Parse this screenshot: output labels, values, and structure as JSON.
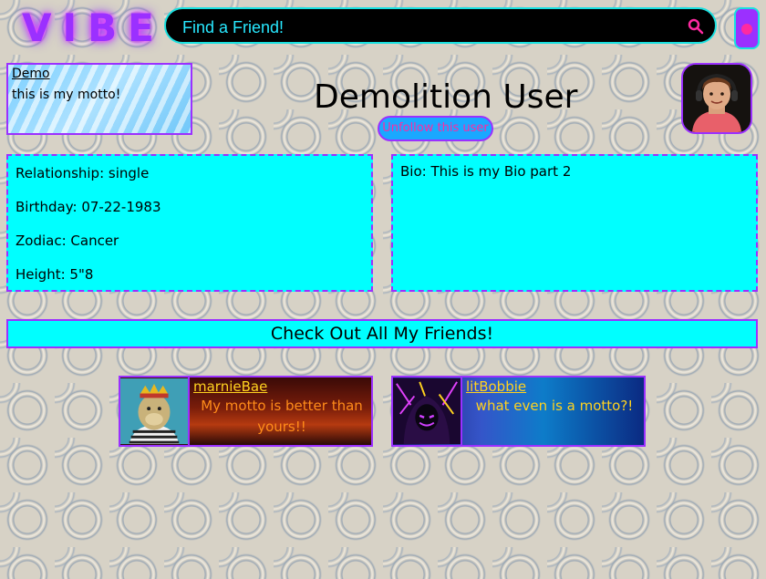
{
  "header": {
    "logo": "VIBE",
    "search": {
      "placeholder": "Find a Friend!"
    }
  },
  "motto_card": {
    "username": "Demo",
    "motto": "this is my motto!"
  },
  "profile": {
    "display_name": "Demolition User",
    "unfollow_label": "Unfollow this user"
  },
  "details": {
    "relationship": "Relationship: single",
    "birthday": "Birthday: 07-22-1983",
    "zodiac": "Zodiac: Cancer",
    "height": "Height: 5\"8"
  },
  "bio": "Bio: This is my Bio part 2",
  "friends_banner": "Check Out All My Friends!",
  "friends": [
    {
      "name": "marnieBae",
      "motto": "My motto is better than yours!!"
    },
    {
      "name": "litBobbie",
      "motto": "what even is a motto?!"
    }
  ],
  "colors": {
    "accent": "#9b30ff",
    "cyan": "#00ffff",
    "pink": "#ff2aa1"
  }
}
